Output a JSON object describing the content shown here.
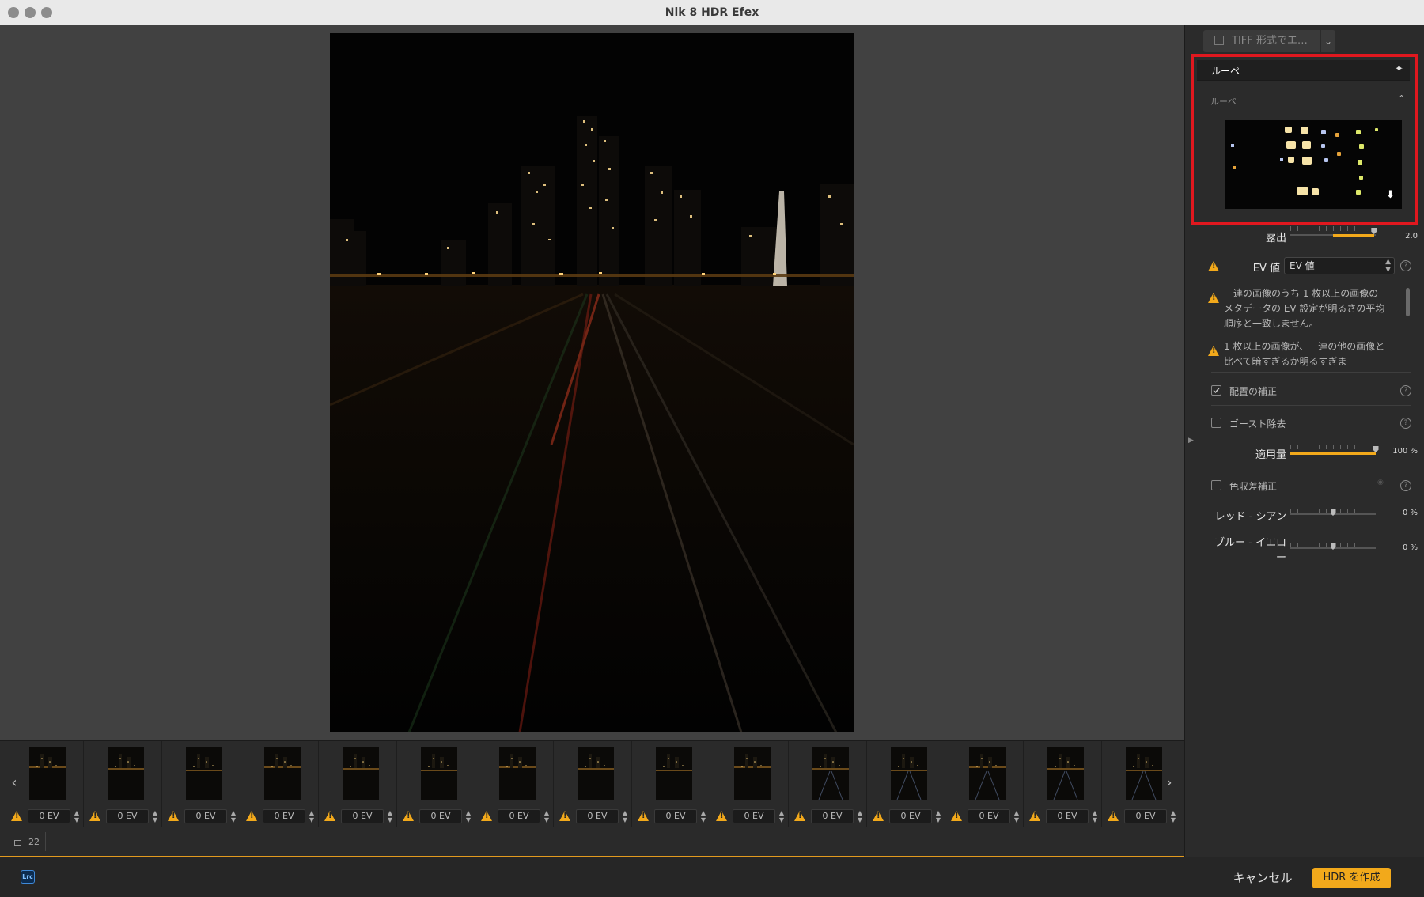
{
  "window": {
    "title": "Nik 8 HDR Efex"
  },
  "filmstrip": {
    "prev_arrow": "‹",
    "next_arrow": "›",
    "thumbnails": [
      {
        "ev": "0 EV"
      },
      {
        "ev": "0 EV"
      },
      {
        "ev": "0 EV"
      },
      {
        "ev": "0 EV"
      },
      {
        "ev": "0 EV"
      },
      {
        "ev": "0 EV"
      },
      {
        "ev": "0 EV"
      },
      {
        "ev": "0 EV"
      },
      {
        "ev": "0 EV"
      },
      {
        "ev": "0 EV"
      },
      {
        "ev": "0 EV"
      },
      {
        "ev": "0 EV"
      },
      {
        "ev": "0 EV"
      },
      {
        "ev": "0 EV"
      },
      {
        "ev": "0 EV"
      }
    ],
    "image_count": "22"
  },
  "footer": {
    "lrc_badge": "Lrc",
    "cancel_label": "キャンセル",
    "create_label": "HDR を作成"
  },
  "panel": {
    "export_label": "TIFF 形式でエ…",
    "export_dropdown": "⌄",
    "loupe": {
      "header": "ルーペ",
      "sub_label": "ルーペ",
      "pin_glyph": "📌",
      "chevron": "⌃"
    },
    "exposure": {
      "label": "露出",
      "value": "2.0",
      "fraction": 0.98
    },
    "ev_value": {
      "label": "EV 値",
      "selected": "EV 値"
    },
    "warnings": [
      "一連の画像のうち 1 枚以上の画像のメタデータの EV 設定が明るさの平均順序と一致しません。",
      "1 枚以上の画像が、一連の他の画像と比べて暗すぎるか明るすぎま"
    ],
    "alignment": {
      "label": "配置の補正",
      "checked": true
    },
    "ghost": {
      "label": "ゴースト除去",
      "checked": false
    },
    "amount": {
      "label": "適用量",
      "value": "100 %",
      "fraction": 1.0
    },
    "chromatic": {
      "label": "色収差補正",
      "checked": false
    },
    "red_cyan": {
      "label": "レッド - シアン",
      "value": "0 %",
      "fraction": 0.5
    },
    "blue_yellow": {
      "label": "ブルー - イエロー",
      "value": "0 %",
      "fraction": 0.5
    }
  },
  "colors": {
    "accent": "#f2a91b",
    "highlight_box": "#e0181f",
    "warning": "#f2a91b"
  }
}
